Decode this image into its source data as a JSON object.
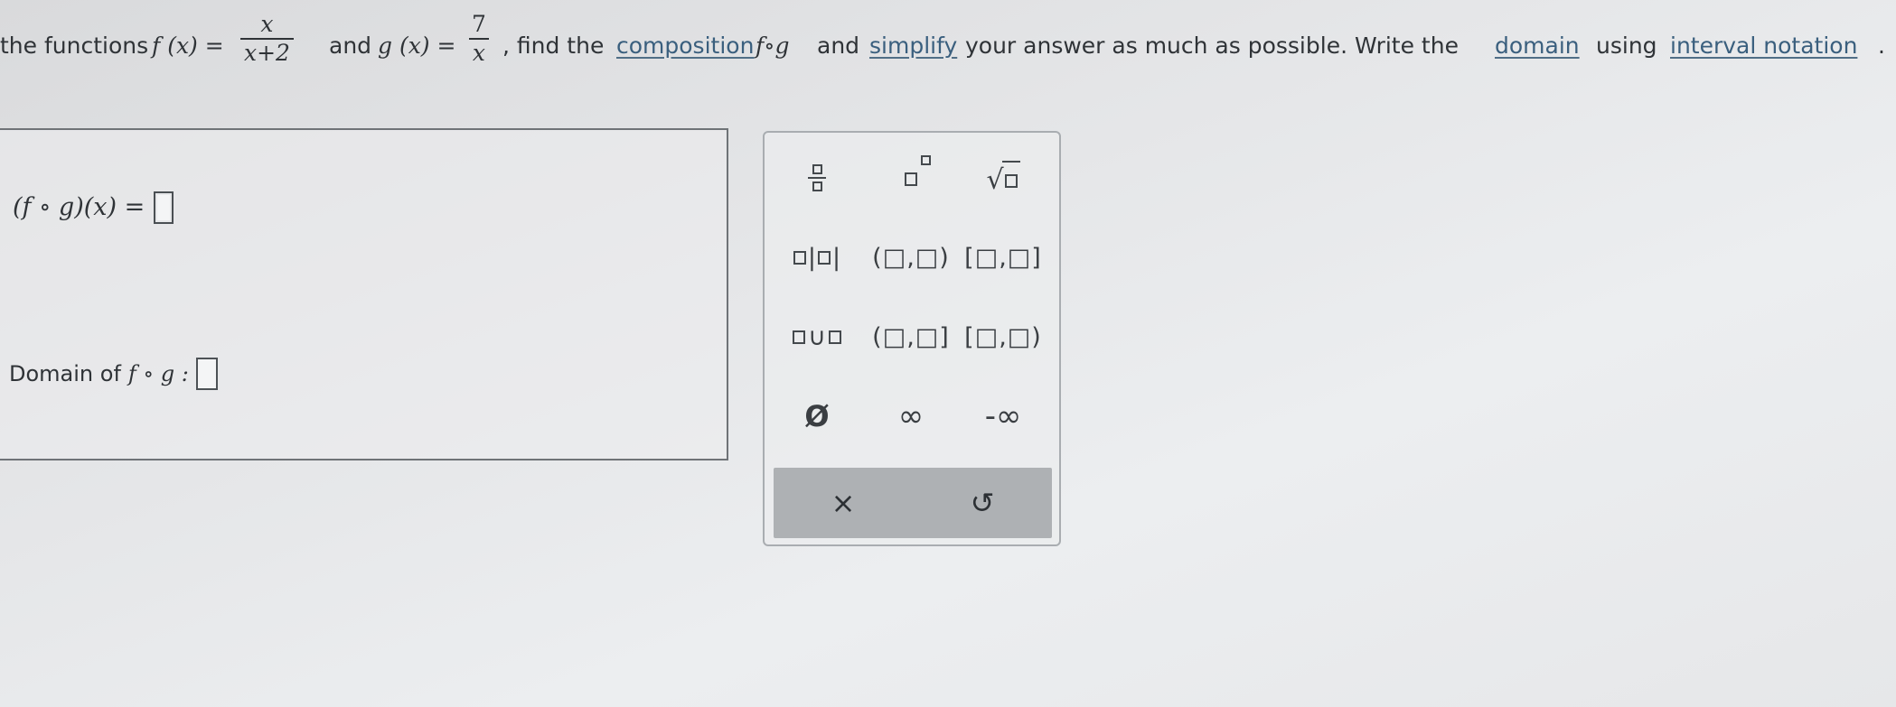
{
  "question": {
    "intro": "the functions",
    "f_def": "f (x) =",
    "f_num": "x",
    "f_den": "x+2",
    "and_text": "and",
    "g_def": "g (x) =",
    "g_num": "7",
    "g_den": "x",
    "comma_find": ", find the",
    "composition_link": "composition",
    "f_o_g": "f∘g",
    "and_text2": "and",
    "simplify_link": "simplify",
    "middle_text": "your answer as much as possible. Write the",
    "domain_link": "domain",
    "using_text": "using",
    "interval_link": "interval notation",
    "period": "."
  },
  "answer": {
    "fog_label": "(f ∘ g)(x) =",
    "domain_label": "Domain of",
    "domain_fog": "f ∘ g :"
  },
  "keypad": {
    "interval_open": "(□,□)",
    "interval_closed": "[□,□]",
    "interval_left_open": "(□,□]",
    "interval_right_open": "[□,□)",
    "union_symbol": "∪",
    "empty_set": "Ø",
    "infinity": "∞",
    "neg_infinity": "-∞",
    "clear": "×",
    "undo": "↺"
  }
}
